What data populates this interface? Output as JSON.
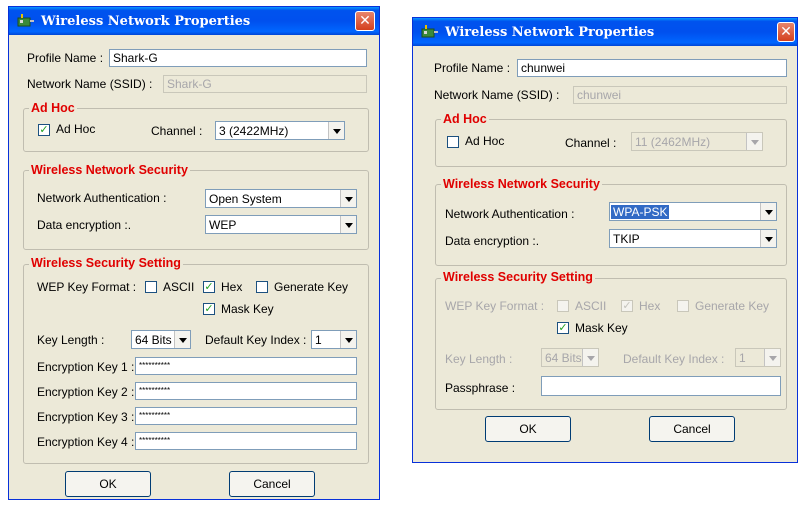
{
  "dialog1": {
    "title": "Wireless Network Properties",
    "profile_label": "Profile Name :",
    "profile_value": "Shark-G",
    "ssid_label": "Network Name (SSID) :",
    "ssid_value": "Shark-G",
    "adhoc": {
      "legend": "Ad Hoc",
      "checkbox_label": "Ad Hoc",
      "checked": true,
      "channel_label": "Channel :",
      "channel_value": "3 (2422MHz)"
    },
    "security": {
      "legend": "Wireless Network Security",
      "auth_label": "Network Authentication :",
      "auth_value": "Open System",
      "enc_label": "Data encryption :.",
      "enc_value": "WEP"
    },
    "setting": {
      "legend": "Wireless Security Setting",
      "wep_format_label": "WEP Key Format :",
      "ascii_label": "ASCII",
      "ascii_checked": false,
      "hex_label": "Hex",
      "hex_checked": true,
      "generate_label": "Generate Key",
      "generate_checked": false,
      "mask_label": "Mask Key",
      "mask_checked": true,
      "key_length_label": "Key Length :",
      "key_length_value": "64 Bits",
      "default_key_label": "Default Key Index :",
      "default_key_value": "1",
      "keys": [
        {
          "label": "Encryption Key 1 :",
          "value": "**********"
        },
        {
          "label": "Encryption Key 2 :",
          "value": "**********"
        },
        {
          "label": "Encryption Key 3 :",
          "value": "**********"
        },
        {
          "label": "Encryption Key 4 :",
          "value": "**********"
        }
      ]
    },
    "ok": "OK",
    "cancel": "Cancel"
  },
  "dialog2": {
    "title": "Wireless Network Properties",
    "profile_label": "Profile Name :",
    "profile_value": "chunwei",
    "ssid_label": "Network Name (SSID) :",
    "ssid_value": "chunwei",
    "adhoc": {
      "legend": "Ad Hoc",
      "checkbox_label": "Ad Hoc",
      "checked": false,
      "channel_label": "Channel :",
      "channel_value": "11 (2462MHz)"
    },
    "security": {
      "legend": "Wireless Network Security",
      "auth_label": "Network Authentication :",
      "auth_value": "WPA-PSK",
      "enc_label": "Data encryption :.",
      "enc_value": "TKIP"
    },
    "setting": {
      "legend": "Wireless Security Setting",
      "wep_format_label": "WEP Key Format :",
      "ascii_label": "ASCII",
      "ascii_checked": false,
      "hex_label": "Hex",
      "hex_checked": true,
      "generate_label": "Generate Key",
      "generate_checked": false,
      "mask_label": "Mask Key",
      "mask_checked": true,
      "key_length_label": "Key Length :",
      "key_length_value": "64 Bits",
      "default_key_label": "Default Key Index :",
      "default_key_value": "1",
      "passphrase_label": "Passphrase :",
      "passphrase_value": ""
    },
    "ok": "OK",
    "cancel": "Cancel"
  },
  "colors": {
    "titlebar": "#0053ee",
    "dialog_bg": "#ece9d8",
    "legend": "#e00000",
    "selection": "#316ac5"
  },
  "icons": {
    "close": "close-icon",
    "app": "network-adapter-icon",
    "dropdown": "chevron-down-icon",
    "check": "check-icon"
  }
}
